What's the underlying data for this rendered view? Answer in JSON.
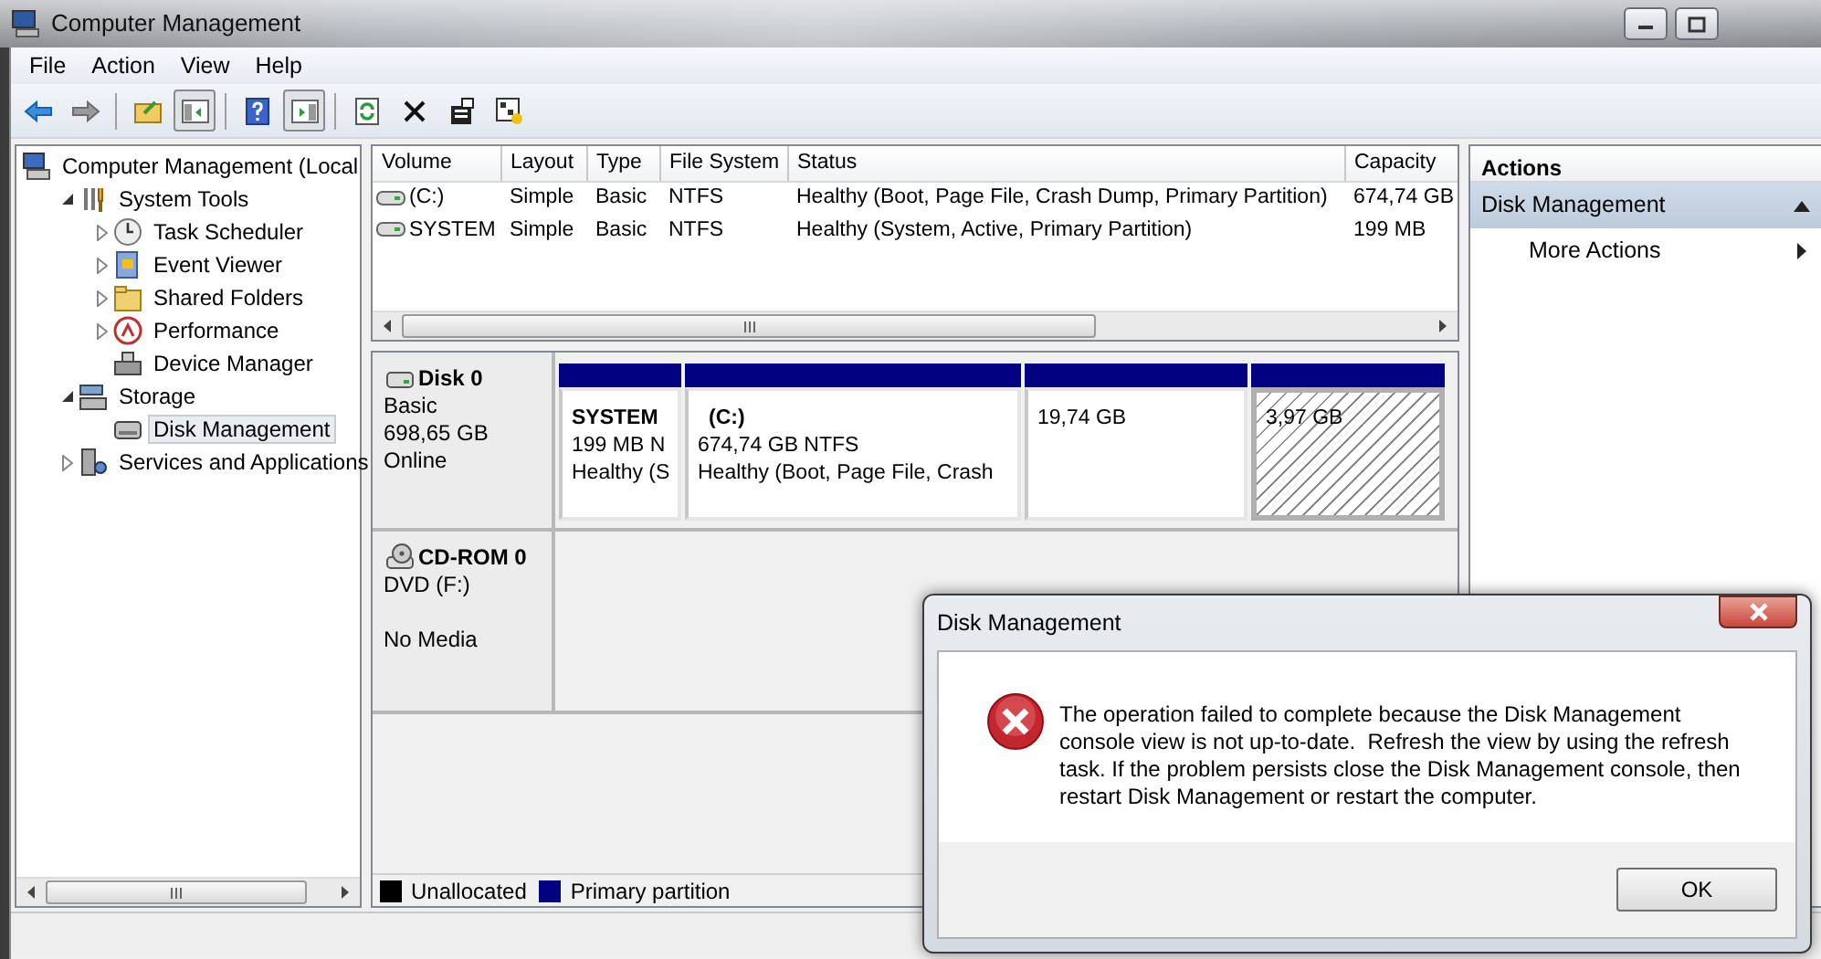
{
  "window": {
    "title": "Computer Management"
  },
  "menu": [
    "File",
    "Action",
    "View",
    "Help"
  ],
  "toolbar": [
    {
      "pressed": false
    },
    {
      "pressed": false
    },
    {
      "pressed": false
    },
    {
      "pressed": true
    },
    {
      "pressed": false
    },
    {
      "pressed": true
    },
    {
      "pressed": false
    },
    {
      "pressed": false
    },
    {
      "pressed": false
    },
    {
      "pressed": false
    }
  ],
  "tree": [
    {
      "label": "Computer Management (Local",
      "selected": false,
      "children": [
        {
          "label": "System Tools",
          "expanded": true,
          "selected": false,
          "children": [
            {
              "label": "Task Scheduler",
              "expanded": false,
              "selected": false
            },
            {
              "label": "Event Viewer",
              "expanded": false,
              "selected": false
            },
            {
              "label": "Shared Folders",
              "expanded": false,
              "selected": false
            },
            {
              "label": "Performance",
              "expanded": false,
              "selected": false
            },
            {
              "label": "Device Manager",
              "selected": false
            }
          ]
        },
        {
          "label": "Storage",
          "expanded": true,
          "selected": false,
          "children": [
            {
              "label": "Disk Management",
              "selected": true
            }
          ]
        },
        {
          "label": "Services and Applications",
          "expanded": false,
          "selected": false
        }
      ]
    }
  ],
  "volumes": {
    "columns": [
      "Volume",
      "Layout",
      "Type",
      "File System",
      "Status",
      "Capacity"
    ],
    "rows": [
      [
        "(C:)",
        "Simple",
        "Basic",
        "NTFS",
        "Healthy (Boot, Page File, Crash Dump, Primary Partition)",
        "674,74 GB"
      ],
      [
        "SYSTEM",
        "Simple",
        "Basic",
        "NTFS",
        "Healthy (System, Active, Primary Partition)",
        "199 MB"
      ]
    ]
  },
  "disks": [
    {
      "kind": "disk",
      "name": "Disk 0",
      "type": "Basic",
      "size": "698,65 GB",
      "status": "Online",
      "partitions": [
        {
          "name": "SYSTEM",
          "lines": [
            "199 MB N",
            "Healthy (S"
          ],
          "selected": false
        },
        {
          "name": "(C:)",
          "lines": [
            "674,74 GB NTFS",
            "Healthy (Boot, Page File, Crash"
          ],
          "selected": false
        },
        {
          "lines": [
            "19,74 GB"
          ],
          "selected": false
        },
        {
          "lines": [
            "3,97 GB"
          ],
          "selected": true
        }
      ]
    },
    {
      "kind": "cdrom",
      "name": "CD-ROM 0",
      "type": "DVD (F:)",
      "status": "No Media"
    }
  ],
  "legend": [
    {
      "label": "Unallocated",
      "color": "#000000"
    },
    {
      "label": "Primary partition",
      "color": "#000080"
    }
  ],
  "actions": {
    "title": "Actions",
    "section": "Disk Management",
    "expanded": true,
    "items": [
      "More Actions"
    ]
  },
  "dialog": {
    "title": "Disk Management",
    "message": "The operation failed to complete because the Disk Management console view is not up-to-date.  Refresh the view by using the refresh task. If the problem persists close the Disk Management console, then restart Disk Management or restart the computer.",
    "button": "OK"
  }
}
